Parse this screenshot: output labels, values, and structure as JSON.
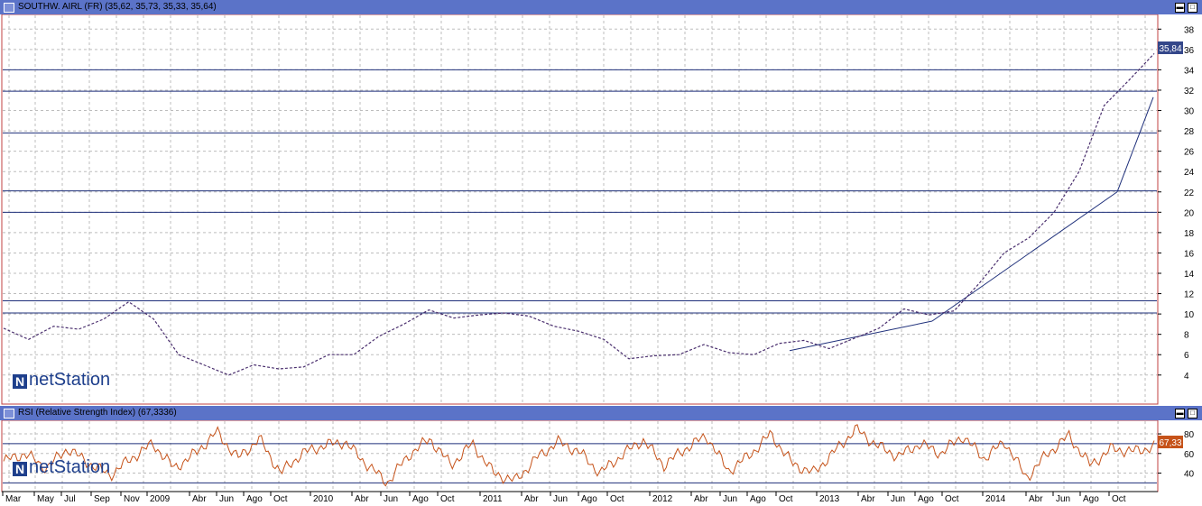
{
  "colors": {
    "header": "#5b73c8",
    "price": "#4a2f6e",
    "rsi": "#c6531a",
    "hline": "#1e2f7a",
    "trend": "#1e2f7a",
    "grid": "#bdbdbd",
    "price_label": "#34478a",
    "rsi_label": "#c6531a"
  },
  "price_panel": {
    "title": "SOUTHW. AIRL (FR) (35,62, 35,73, 35,33, 35,64)",
    "last_value_label": "35,84",
    "watermark_brand": "netStation",
    "watermark_logo": "N"
  },
  "rsi_panel": {
    "title": "RSI (Relative Strength Index) (67,3336)",
    "last_value_label": "67,33",
    "watermark_brand": "netStation",
    "watermark_logo": "N"
  },
  "window_buttons": {
    "minimize": "▬",
    "maximize": "□"
  },
  "chart_data": [
    {
      "type": "line",
      "series": [
        {
          "values": [
            8.6,
            7.5,
            8.8,
            8.5,
            9.5,
            11.2,
            9.5,
            6.0,
            5.0,
            4.0,
            5.0,
            4.6,
            4.8,
            6.0,
            6.0,
            7.8,
            9.0,
            10.4,
            9.6,
            9.9,
            10.1,
            9.8,
            8.8,
            8.3,
            7.5,
            5.6,
            5.9,
            6.0,
            7.0,
            6.2,
            6.0,
            7.1,
            7.4,
            6.6,
            7.6,
            8.6,
            10.5,
            9.9,
            10.3,
            13.0,
            16.0,
            17.5,
            20.0,
            24.0,
            30.5,
            33.0,
            35.6
          ]
        }
      ],
      "x_tick_labels": [
        "Mar",
        "May",
        "Jul",
        "Sep",
        "Nov",
        "2009",
        "Abr",
        "Jun",
        "Ago",
        "Oct",
        "2010",
        "Abr",
        "Jun",
        "Ago",
        "Oct",
        "2011",
        "Abr",
        "Jun",
        "Ago",
        "Oct",
        "2012",
        "Abr",
        "Jun",
        "Ago",
        "Oct",
        "2013",
        "Abr",
        "Jun",
        "Ago",
        "Oct",
        "2014",
        "Abr",
        "Jun",
        "Ago",
        "Oct"
      ],
      "y_ticks": [
        4,
        6,
        8,
        10,
        12,
        14,
        16,
        18,
        20,
        22,
        24,
        26,
        28,
        30,
        32,
        34,
        36,
        38
      ],
      "ylim": [
        1.5,
        39
      ],
      "horizontal_lines": [
        10.1,
        11.3,
        20.0,
        22.1,
        27.8,
        31.9,
        34.0
      ],
      "trend_lines": [
        [
          [
            6.4,
            875
          ],
          [
            9.3,
            1033
          ]
        ],
        [
          [
            9.3,
            1033
          ],
          [
            22.0,
            1238
          ]
        ],
        [
          [
            22.0,
            1238
          ],
          [
            31.3,
            1278
          ]
        ]
      ],
      "grid": true
    },
    {
      "type": "line",
      "series": [
        {
          "values": [
            52,
            60,
            45,
            65,
            50,
            38,
            55,
            70,
            45,
            60,
            82,
            55,
            75,
            40,
            60,
            68,
            72,
            50,
            30,
            58,
            75,
            48,
            70,
            40,
            32,
            55,
            72,
            62,
            40,
            58,
            74,
            48,
            65,
            78,
            42,
            58,
            80,
            50,
            40,
            62,
            85,
            68,
            57,
            70,
            60,
            78,
            55,
            72,
            35,
            60,
            78,
            48,
            65,
            62,
            67
          ]
        }
      ],
      "y_ticks": [
        40,
        60,
        80
      ],
      "ylim": [
        23,
        92
      ],
      "horizontal_lines": [
        30,
        70
      ],
      "grid": true
    }
  ]
}
